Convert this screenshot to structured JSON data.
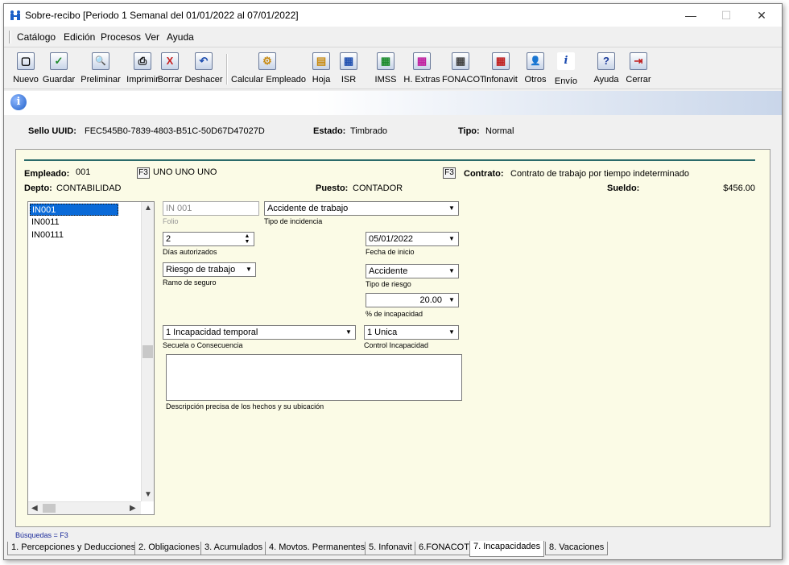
{
  "window": {
    "title": "Sobre-recibo  [Periodo 1 Semanal del 01/01/2022 al 07/01/2022]",
    "minimize": "—",
    "maximize": "☐",
    "close": "✕"
  },
  "menu": [
    "Catálogo",
    "Edición",
    "Procesos",
    "Ver",
    "Ayuda"
  ],
  "toolbar": [
    {
      "label": "Nuevo",
      "icon": "new-icon",
      "glyph": "▢"
    },
    {
      "label": "Guardar",
      "icon": "save-icon",
      "glyph": "✓"
    },
    {
      "label": "Preliminar",
      "icon": "preview-icon",
      "glyph": "🔍"
    },
    {
      "label": "Imprimir",
      "icon": "print-icon",
      "glyph": "⎙"
    },
    {
      "label": "Borrar",
      "icon": "delete-icon",
      "glyph": "X"
    },
    {
      "label": "Deshacer",
      "icon": "undo-icon",
      "glyph": "↶"
    },
    {
      "label": "Calcular Empleado",
      "icon": "calculate-icon",
      "glyph": "⚙"
    },
    {
      "label": "Hoja",
      "icon": "sheet-icon",
      "glyph": "▤"
    },
    {
      "label": "ISR",
      "icon": "isr-icon",
      "glyph": "▦"
    },
    {
      "label": "IMSS",
      "icon": "imss-icon",
      "glyph": "▦"
    },
    {
      "label": "H. Extras",
      "icon": "extra-hours-icon",
      "glyph": "▦"
    },
    {
      "label": "FONACOT",
      "icon": "fonacot-icon",
      "glyph": "▦"
    },
    {
      "label": "Infonavit",
      "icon": "infonavit-icon",
      "glyph": "▦"
    },
    {
      "label": "Otros",
      "icon": "others-icon",
      "glyph": "👤"
    },
    {
      "label": "Envío",
      "icon": "send-icon",
      "glyph": "i"
    },
    {
      "label": "Ayuda",
      "icon": "help-icon",
      "glyph": "?"
    },
    {
      "label": "Cerrar",
      "icon": "close-door-icon",
      "glyph": "⇥"
    }
  ],
  "status": {
    "uuid_label": "Sello UUID:",
    "uuid_value": "FEC545B0-7839-4803-B51C-50D67D47027D",
    "estado_label": "Estado:",
    "estado_value": "Timbrado",
    "tipo_label": "Tipo:",
    "tipo_value": "Normal"
  },
  "employee": {
    "empleado_label": "Empleado:",
    "empleado_code": "001",
    "f3": "F3",
    "empleado_name": "UNO UNO UNO",
    "contrato_label": "Contrato:",
    "contrato_value": "Contrato de trabajo por tiempo indeterminado",
    "depto_label": "Depto:",
    "depto_value": "CONTABILIDAD",
    "puesto_label": "Puesto:",
    "puesto_value": "CONTADOR",
    "sueldo_label": "Sueldo:",
    "sueldo_value": "$456.00"
  },
  "list": [
    "IN001",
    "IN0011",
    "IN00111"
  ],
  "form": {
    "folio_value": "IN 001",
    "folio_label": "Folio",
    "tipo_incidencia_value": "Accidente de trabajo",
    "tipo_incidencia_label": "Tipo de incidencia",
    "dias_value": "2",
    "dias_label": "Días autorizados",
    "fecha_value": "05/01/2022",
    "fecha_label": "Fecha de inicio",
    "ramo_value": "Riesgo de trabajo",
    "ramo_label": "Ramo de seguro",
    "tipo_riesgo_value": "Accidente",
    "tipo_riesgo_label": "Tipo de riesgo",
    "incapacidad_value": "20.00",
    "incapacidad_label": "% de incapacidad",
    "secuela_value": "1 Incapacidad temporal",
    "secuela_label": "Secuela o Consecuencia",
    "control_value": "1 Unica",
    "control_label": "Control Incapacidad",
    "descripcion_label": "Descripción precisa de los hechos y su ubicación"
  },
  "busquedas": "Búsquedas = F3",
  "tabs": [
    "1. Percepciones y Deducciones",
    "2. Obligaciones",
    "3. Acumulados",
    "4. Movtos. Permanentes",
    "5. Infonavit",
    "6.FONACOT",
    "7. Incapacidades",
    "8. Vacaciones"
  ],
  "active_tab": 6
}
